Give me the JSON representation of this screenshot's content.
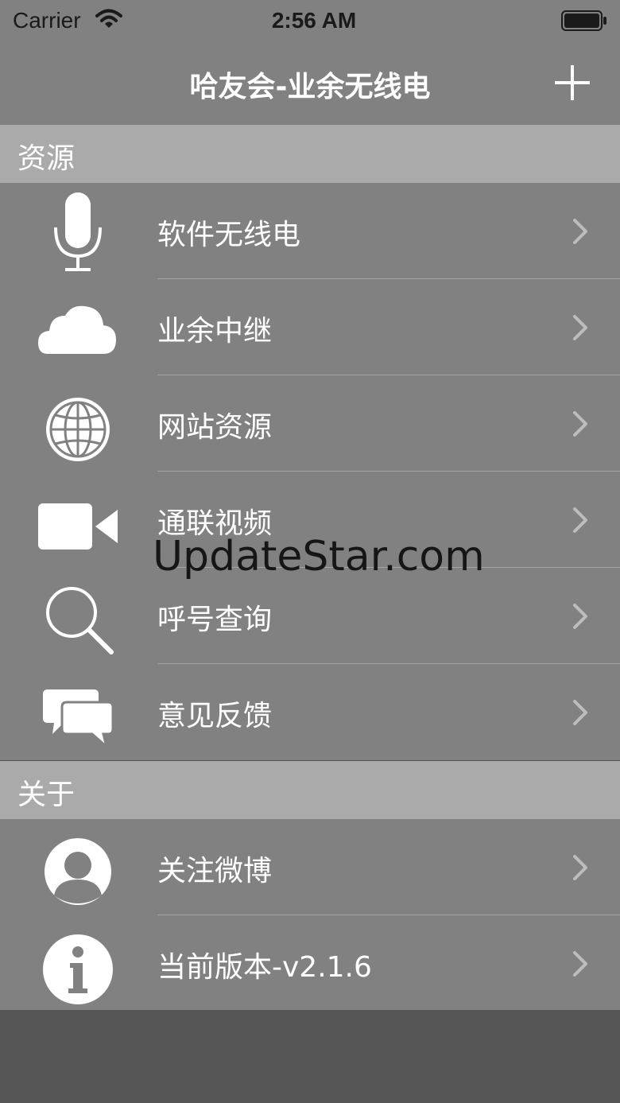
{
  "status_bar": {
    "carrier": "Carrier",
    "time": "2:56 AM",
    "wifi_icon": "wifi-icon",
    "battery_icon": "battery-icon"
  },
  "nav_bar": {
    "title": "哈友会-业余无线电",
    "add_icon": "plus-icon"
  },
  "sections": [
    {
      "header": "资源",
      "items": [
        {
          "label": "软件无线电",
          "icon": "microphone-icon"
        },
        {
          "label": "业余中继",
          "icon": "cloud-icon"
        },
        {
          "label": "网站资源",
          "icon": "globe-icon"
        },
        {
          "label": "通联视频",
          "icon": "video-camera-icon"
        },
        {
          "label": "呼号查询",
          "icon": "search-icon"
        },
        {
          "label": "意见反馈",
          "icon": "chat-bubbles-icon"
        }
      ]
    },
    {
      "header": "关于",
      "items": [
        {
          "label": "关注微博",
          "icon": "user-icon"
        },
        {
          "label": "当前版本-v2.1.6",
          "icon": "info-icon"
        }
      ]
    }
  ],
  "watermark": "UpdateStar.com",
  "colors": {
    "row_bg": "#818181",
    "section_header_bg": "#aaaaaa",
    "separator": "#a3a3a3",
    "footer_bg": "#555555",
    "text": "#ffffff"
  }
}
